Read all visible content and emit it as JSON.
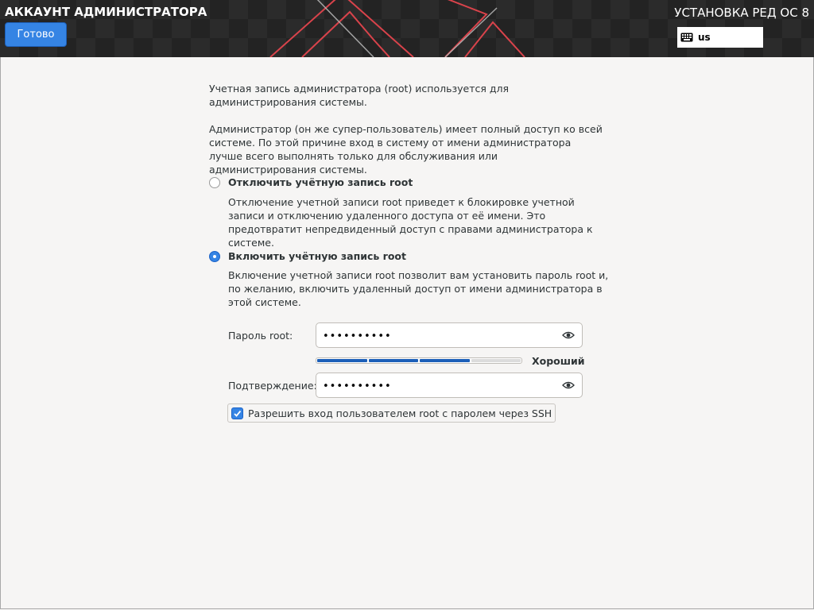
{
  "header": {
    "spoke_title": "АККАУНТ АДМИНИСТРАТОРА",
    "done_label": "Готово",
    "product_title": "УСТАНОВКА РЕД ОС 8",
    "keyboard_layout": "us",
    "keyboard_icon": "keyboard-icon"
  },
  "intro": {
    "p1": "Учетная запись администратора (root) используется для администрирования системы.",
    "p2": "Администратор (он же супер-пользователь) имеет полный доступ ко всей системе. По этой причине вход в систему от имени администратора лучше всего выполнять только для обслуживания или администрирования системы."
  },
  "options": {
    "disable": {
      "label": "Отключить учётную запись root",
      "description": "Отключение учетной записи root приведет к блокировке учетной записи и отключению удаленного доступа от её имени. Это предотвратит непредвиденный доступ с правами администратора к системе.",
      "selected": false
    },
    "enable": {
      "label": "Включить учётную запись root",
      "description": "Включение учетной записи root позволит вам установить пароль root и, по желанию, включить удаленный доступ от имени администратора в этой системе.",
      "selected": true
    }
  },
  "password": {
    "root_label": "Пароль root:",
    "root_value": "••••••••••",
    "confirm_label": "Подтверждение:",
    "confirm_value": "••••••••••",
    "strength_label": "Хороший",
    "strength_level": 0.75,
    "strength_color": "#1c5fb8",
    "show_icon": "eye-icon"
  },
  "ssh": {
    "label": "Разрешить вход пользователем root с паролем через SSH",
    "checked": true
  },
  "colors": {
    "accent": "#3584e4",
    "header_bg": "#2b2b2b",
    "decor": "#e0464e"
  }
}
